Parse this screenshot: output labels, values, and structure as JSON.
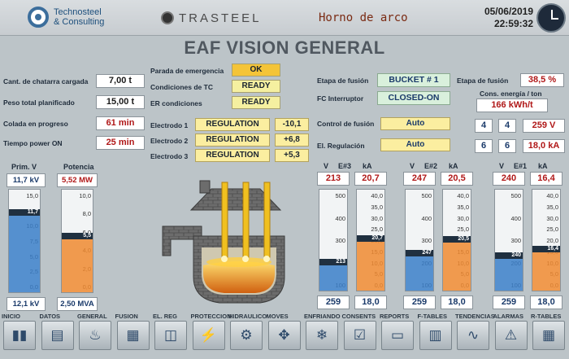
{
  "header": {
    "brand1": "Technosteel",
    "brand1b": "& Consulting",
    "brand2": "TRASTEEL",
    "title": "Horno de arco",
    "date": "05/06/2019",
    "time": "22:59:32"
  },
  "main_title": "EAF VISION GENERAL",
  "left": {
    "scrap_label": "Cant. de chatarra cargada",
    "scrap": "7,00 t",
    "weight_label": "Peso total planificado",
    "weight": "15,00 t",
    "tap_label": "Colada en progreso",
    "tap": "61 min",
    "power_label": "Tiempo power ON",
    "power": "25 min"
  },
  "status": {
    "emerg_label": "Parada de emergencia",
    "emerg": "OK",
    "tc_label": "Condiciones de TC",
    "tc": "READY",
    "er_label": "ER condiciones",
    "er": "READY"
  },
  "electrodes": [
    {
      "label": "Electrodo 1",
      "state": "REGULATION",
      "value": "-10,1"
    },
    {
      "label": "Electrodo 2",
      "state": "REGULATION",
      "value": "+6,8"
    },
    {
      "label": "Electrodo 3",
      "state": "REGULATION",
      "value": "+5,3"
    }
  ],
  "right": {
    "stage_label": "Etapa de fusión",
    "stage": "BUCKET # 1",
    "stage2_label": "Etapa de fusión",
    "stage_pct": "38,5 %",
    "fc_label": "FC Interruptor",
    "fc": "CLOSED-ON",
    "cons_label": "Cons. energía / ton",
    "cons": "166  kWh/t",
    "ctrl_label": "Control de fusión",
    "ctrl": "Auto",
    "reg_label": "El. Regulación",
    "reg": "Auto",
    "n1": "4",
    "n2": "4",
    "volt": "259 V",
    "n3": "6",
    "n4": "6",
    "ka": "18,0 kA"
  },
  "transformer": {
    "primv_label": "Prim. V",
    "primv": "11,7 kV",
    "pot_label": "Potencia",
    "pot": "5,52 MW",
    "primv_bottom": "12,1 kV",
    "pot_bottom": "2,50 MVA",
    "primv_ticks": [
      "15,0",
      "12,5",
      "10,0",
      "7,5",
      "5,0",
      "2,5",
      "0,0"
    ],
    "pot_ticks": [
      "10,0",
      "8,0",
      "6,0",
      "4,0",
      "2,0",
      "0,0"
    ],
    "primv_marker": "11,7",
    "pot_marker": "5,5",
    "primv_level": 0.78,
    "pot_level": 0.55,
    "primv_color": "#3a7ec8",
    "pot_color": "#f08a30"
  },
  "electrode_groups": [
    {
      "v_label": "V",
      "e_label": "E#3",
      "ka_label": "kA",
      "v": "213",
      "ka": "20,7",
      "v_bottom": "259",
      "ka_bottom": "18,0",
      "v_marker": "213",
      "ka_marker": "20,7",
      "v_level": 0.28,
      "ka_level": 0.52
    },
    {
      "v_label": "V",
      "e_label": "E#2",
      "ka_label": "kA",
      "v": "247",
      "ka": "20,5",
      "v_bottom": "259",
      "ka_bottom": "18,0",
      "v_marker": "247",
      "ka_marker": "20,5",
      "v_level": 0.37,
      "ka_level": 0.51
    },
    {
      "v_label": "V",
      "e_label": "E#1",
      "ka_label": "kA",
      "v": "240",
      "ka": "16,4",
      "v_bottom": "259",
      "ka_bottom": "18,0",
      "v_marker": "240",
      "ka_marker": "16,4",
      "v_level": 0.35,
      "ka_level": 0.41
    }
  ],
  "v_ticks": [
    "500",
    "400",
    "300",
    "200",
    "100"
  ],
  "ka_ticks": [
    "40,0",
    "35,0",
    "30,0",
    "25,0",
    "20,0",
    "15,0",
    "10,0",
    "5,0",
    "0,0"
  ],
  "nav": [
    {
      "label": "INICIO",
      "icon": "▮▮"
    },
    {
      "label": "DATOS",
      "icon": "▤"
    },
    {
      "label": "GENERAL",
      "icon": "♨"
    },
    {
      "label": "FUSION",
      "icon": "▦"
    },
    {
      "label": "EL. REG",
      "icon": "◫"
    },
    {
      "label": "PROTECCION",
      "icon": "⚡"
    },
    {
      "label": "HIDRAULICO",
      "icon": "⚙"
    },
    {
      "label": "MOVES",
      "icon": "✥"
    },
    {
      "label": "ENFRIANDO",
      "icon": "❄"
    },
    {
      "label": "CONSENTS",
      "icon": "☑"
    },
    {
      "label": "REPORTS",
      "icon": "▭"
    },
    {
      "label": "F-TABLES",
      "icon": "▥"
    },
    {
      "label": "TENDENCIAS",
      "icon": "∿"
    },
    {
      "label": "ALARMAS",
      "icon": "⚠"
    },
    {
      "label": "R-TABLES",
      "icon": "▦"
    }
  ]
}
